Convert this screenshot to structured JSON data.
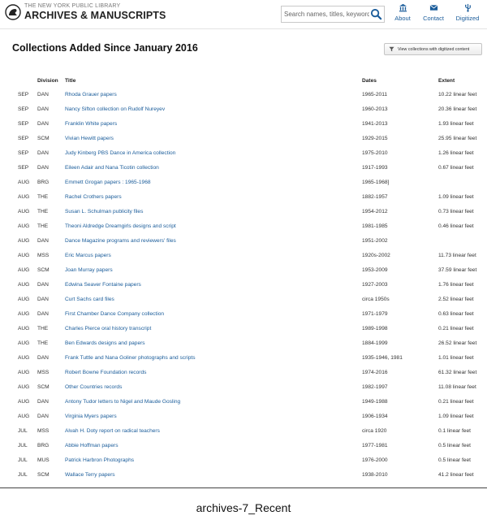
{
  "header": {
    "brand_top": "THE NEW YORK PUBLIC LIBRARY",
    "brand_main": "ARCHIVES & MANUSCRIPTS",
    "search_placeholder": "Search names, titles, keywords...",
    "nav": [
      {
        "label": "About",
        "icon": "building-icon"
      },
      {
        "label": "Contact",
        "icon": "envelope-icon"
      },
      {
        "label": "Digitized",
        "icon": "usb-icon"
      }
    ],
    "accent_color": "#1a5c9a"
  },
  "page": {
    "title": "Collections Added Since January 2016",
    "view_button": "View collections with digitized content"
  },
  "table": {
    "headers": {
      "division": "Division",
      "title": "Title",
      "dates": "Dates",
      "extent": "Extent"
    },
    "rows": [
      {
        "month": "SEP",
        "division": "DAN",
        "title": "Rhoda Grauer papers",
        "dates": "1965-2011",
        "extent": "10.22 linear feet"
      },
      {
        "month": "SEP",
        "division": "DAN",
        "title": "Nancy Sifton collection on Rudolf Nureyev",
        "dates": "1960-2013",
        "extent": "20.36 linear feet"
      },
      {
        "month": "SEP",
        "division": "DAN",
        "title": "Franklin White papers",
        "dates": "1941-2013",
        "extent": "1.93 linear feet"
      },
      {
        "month": "SEP",
        "division": "SCM",
        "title": "Vivian Hewitt papers",
        "dates": "1929-2015",
        "extent": "25.95 linear feet"
      },
      {
        "month": "SEP",
        "division": "DAN",
        "title": "Judy Kinberg PBS Dance in America collection",
        "dates": "1975-2010",
        "extent": "1.26 linear feet"
      },
      {
        "month": "SEP",
        "division": "DAN",
        "title": "Eileen Adair and Nana Ticotin collection",
        "dates": "1917-1993",
        "extent": "0.67 linear feet"
      },
      {
        "month": "AUG",
        "division": "BRG",
        "title": "Emmett Grogan papers : 1965-1968",
        "dates": "1965-1968]",
        "extent": ""
      },
      {
        "month": "AUG",
        "division": "THE",
        "title": "Rachel Crothers papers",
        "dates": "1882-1957",
        "extent": "1.09 linear feet"
      },
      {
        "month": "AUG",
        "division": "THE",
        "title": "Susan L. Schulman publicity files",
        "dates": "1954-2012",
        "extent": "0.73 linear feet"
      },
      {
        "month": "AUG",
        "division": "THE",
        "title": "Theoni Aldredge Dreamgirls designs and script",
        "dates": "1981-1985",
        "extent": "0.46 linear feet"
      },
      {
        "month": "AUG",
        "division": "DAN",
        "title": "Dance Magazine programs and reviewers' files",
        "dates": "1951-2002",
        "extent": ""
      },
      {
        "month": "AUG",
        "division": "MSS",
        "title": "Eric Marcus papers",
        "dates": "1920s-2002",
        "extent": "11.73 linear feet"
      },
      {
        "month": "AUG",
        "division": "SCM",
        "title": "Joan Murray papers",
        "dates": "1953-2009",
        "extent": "37.59 linear feet"
      },
      {
        "month": "AUG",
        "division": "DAN",
        "title": "Edwina Seaver Fontaine papers",
        "dates": "1927-2003",
        "extent": "1.76 linear feet"
      },
      {
        "month": "AUG",
        "division": "DAN",
        "title": "Curt Sachs card files",
        "dates": "circa 1950s",
        "extent": "2.52 linear feet"
      },
      {
        "month": "AUG",
        "division": "DAN",
        "title": "First Chamber Dance Company collection",
        "dates": "1971-1979",
        "extent": "0.63 linear feet"
      },
      {
        "month": "AUG",
        "division": "THE",
        "title": "Charles Pierce oral history transcript",
        "dates": "1989-1998",
        "extent": "0.21 linear feet"
      },
      {
        "month": "AUG",
        "division": "THE",
        "title": "Ben Edwards designs and papers",
        "dates": "1884-1999",
        "extent": "26.52 linear feet"
      },
      {
        "month": "AUG",
        "division": "DAN",
        "title": "Frank Tuttle and Nana Goliner photographs and scripts",
        "dates": "1935-1946, 1981",
        "extent": "1.01 linear feet"
      },
      {
        "month": "AUG",
        "division": "MSS",
        "title": "Robert Bowne Foundation records",
        "dates": "1974-2016",
        "extent": "61.32 linear feet"
      },
      {
        "month": "AUG",
        "division": "SCM",
        "title": "Other Countries records",
        "dates": "1982-1997",
        "extent": "11.08 linear feet"
      },
      {
        "month": "AUG",
        "division": "DAN",
        "title": "Antony Tudor letters to Nigel and Maude Gosling",
        "dates": "1949-1988",
        "extent": "0.21 linear feet"
      },
      {
        "month": "AUG",
        "division": "DAN",
        "title": "Virginia Myers papers",
        "dates": "1906-1934",
        "extent": "1.09 linear feet"
      },
      {
        "month": "JUL",
        "division": "MSS",
        "title": "Alvah H. Doty report on radical teachers",
        "dates": "circa 1920",
        "extent": "0.1 linear feet"
      },
      {
        "month": "JUL",
        "division": "BRG",
        "title": "Abbie Hoffman papers",
        "dates": "1977-1981",
        "extent": "0.5 linear feet"
      },
      {
        "month": "JUL",
        "division": "MUS",
        "title": "Patrick Harbron Photographs",
        "dates": "1976-2000",
        "extent": "0.5 linear feet"
      },
      {
        "month": "JUL",
        "division": "SCM",
        "title": "Wallace Terry papers",
        "dates": "1938-2010",
        "extent": "41.2 linear feet"
      }
    ]
  },
  "caption": "archives-7_Recent"
}
